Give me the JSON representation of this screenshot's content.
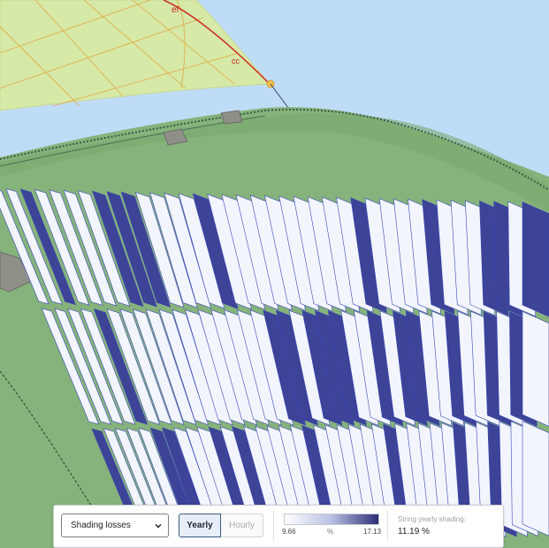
{
  "view": {
    "sky_color": "#bfdcf7",
    "terrain_color": "#86b37b",
    "map_overlay_color": "#d6e9a7",
    "panel_fill_light": "#f2f5fd",
    "panel_fill_dark": "#3d4396",
    "compass_labels": [
      "ef",
      "cc"
    ]
  },
  "toolbar": {
    "metric_select": {
      "value": "Shading losses"
    },
    "period_toggle": {
      "yearly_label": "Yearly",
      "hourly_label": "Hourly",
      "selected": "Yearly"
    },
    "legend": {
      "min": "9.66",
      "unit": "%",
      "max": "17.13",
      "color_low": "#ffffff",
      "color_high": "#2b2f74"
    },
    "stat": {
      "label": "String yearly shading:",
      "value": "11.19 %"
    }
  }
}
